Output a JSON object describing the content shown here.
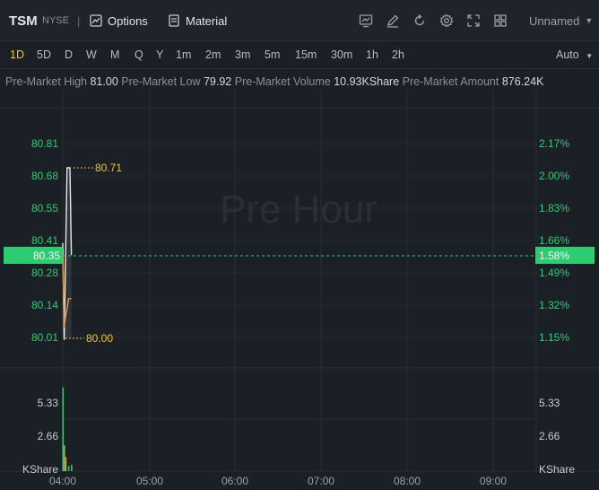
{
  "header": {
    "symbol": "TSM",
    "exchange": "NYSE",
    "options_label": "Options",
    "material_label": "Material",
    "layout_name": "Unnamed",
    "icons": [
      "chart-type-icon",
      "draw-icon",
      "reset-icon",
      "settings-icon",
      "fullscreen-icon",
      "grid-layout-icon"
    ]
  },
  "periods": [
    "1D",
    "5D",
    "D",
    "W",
    "M",
    "Q",
    "Y",
    "1m",
    "2m",
    "3m",
    "5m",
    "15m",
    "30m",
    "1h",
    "2h"
  ],
  "active_period": "1D",
  "auto_label": "Auto",
  "premarket": {
    "high_label": "Pre-Market High",
    "high": "81.00",
    "low_label": "Pre-Market Low",
    "low": "79.92",
    "volume_label": "Pre-Market Volume",
    "volume": "10.93KShare",
    "amount_label": "Pre-Market Amount",
    "amount": "876.24K"
  },
  "watermark": "Pre Hour",
  "current_price": "80.35",
  "current_pct": "1.58%",
  "max_label": "80.71",
  "min_label": "80.00",
  "colors": {
    "up": "#2ecc71",
    "accent": "#f5c518",
    "bg": "#1b1f26"
  },
  "chart_data": {
    "type": "line",
    "price_ticks": [
      "80.81",
      "80.68",
      "80.55",
      "80.41",
      "80.28",
      "80.14",
      "80.01"
    ],
    "pct_ticks": [
      "2.17%",
      "2.00%",
      "1.83%",
      "1.66%",
      "1.49%",
      "1.32%",
      "1.15%"
    ],
    "time_ticks": [
      "04:00",
      "05:00",
      "06:00",
      "07:00",
      "08:00",
      "09:00"
    ],
    "volume_ticks": [
      "5.33",
      "2.66"
    ],
    "volume_unit": "KShare",
    "ylim": [
      80.01,
      80.81
    ],
    "price": [
      {
        "t": "04:00",
        "v": 80.4
      },
      {
        "t": "04:01",
        "v": 80.0
      },
      {
        "t": "04:03",
        "v": 80.71
      },
      {
        "t": "04:05",
        "v": 80.71
      },
      {
        "t": "04:06",
        "v": 80.35
      }
    ],
    "avg": [
      {
        "t": "04:00",
        "v": 80.35
      },
      {
        "t": "04:01",
        "v": 80.05
      },
      {
        "t": "04:02",
        "v": 80.1
      },
      {
        "t": "04:03",
        "v": 80.13
      },
      {
        "t": "04:04",
        "v": 80.17
      },
      {
        "t": "04:06",
        "v": 80.17
      }
    ],
    "volume": [
      {
        "t": "04:00",
        "v": 6.5,
        "dir": "up"
      },
      {
        "t": "04:01",
        "v": 2.0,
        "dir": "down"
      },
      {
        "t": "04:02",
        "v": 1.1,
        "dir": "down"
      },
      {
        "t": "04:04",
        "v": 0.4,
        "dir": "up"
      },
      {
        "t": "04:06",
        "v": 0.5,
        "dir": "up"
      }
    ]
  }
}
